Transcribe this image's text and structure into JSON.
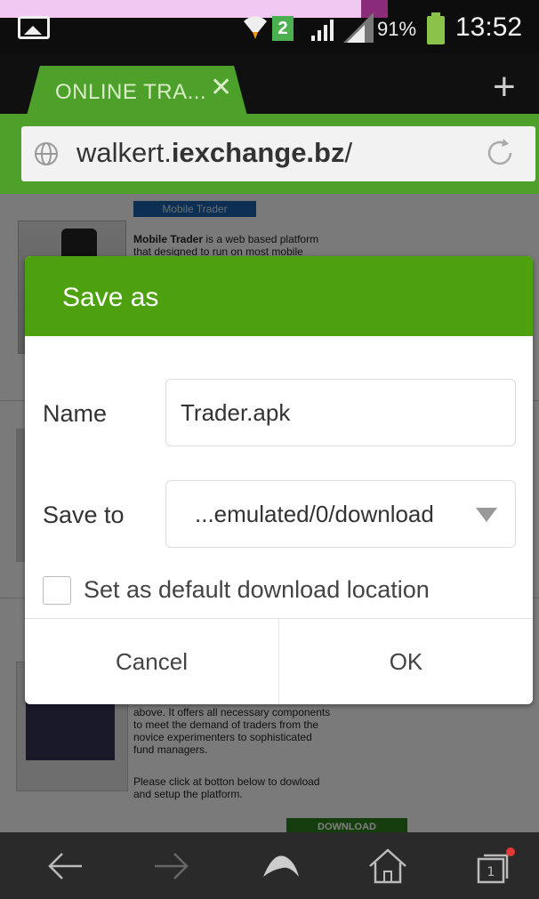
{
  "status_bar": {
    "sim_number": "2",
    "battery_percent": "91%",
    "time": "13:52"
  },
  "browser": {
    "tab_title": "ONLINE TRA...",
    "url_prefix": "walkert.",
    "url_domain": "iexchange.bz",
    "url_suffix": "/"
  },
  "page": {
    "banner": "Mobile Trader",
    "intro_bold": "Mobile Trader",
    "intro_text": " is a web based platform",
    "intro_line2": "that designed to run on most mobile",
    "body_lines": [
      "above. It offers all necessary components",
      "to meet the demand of traders from the",
      "novice experimenters to sophisticated",
      "fund managers."
    ],
    "cta_lines": [
      "Please click at botton below to dowload",
      "and setup the platform."
    ],
    "download_label": "DOWNLOAD"
  },
  "dialog": {
    "title": "Save as",
    "name_label": "Name",
    "name_value": "Trader.apk",
    "save_to_label": "Save to",
    "save_to_value": "...emulated/0/download",
    "default_checkbox_label": "Set as default download location",
    "default_checked": false,
    "cancel_label": "Cancel",
    "ok_label": "OK"
  },
  "bottom_nav": {
    "tab_count": "1"
  },
  "colors": {
    "accent_green": "#4da00e",
    "tab_green": "#4da02a",
    "notification_red": "#e53935"
  }
}
